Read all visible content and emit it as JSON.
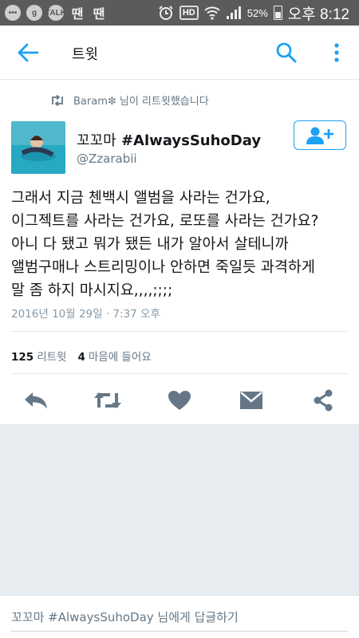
{
  "status_bar": {
    "icons_left": [
      "chat-bubble",
      "g-circle",
      "talk",
      "ttan",
      "ttan"
    ],
    "talk_label": "TALK",
    "ttan_label": "땐",
    "hd": "HD",
    "battery": "52%",
    "time": "오후 8:12"
  },
  "app_bar": {
    "title": "트윗",
    "accent": "#1da1f2"
  },
  "tweet": {
    "retweeted_by": "Baram✼ 님이 리트윗했습니다",
    "author_name_prefix": "꼬꼬마",
    "author_name_tag": "#AlwaysSuhoDay",
    "handle": "@Zzarabii",
    "text_lines": [
      "그래서 지금 첸백시 앨범을 사라는 건가요,",
      "이그젝트를 사라는 건가요, 로또를 사라는 건가요?",
      "아니 다 됐고 뭐가 됐든 내가 알아서 살테니까",
      "앨범구매나 스트리밍이나 안하면 죽일듯 과격하게",
      "말 좀 하지 마시지요,,,,;;;;"
    ],
    "timestamp": "2016년 10월 29일 · 7:37 오후",
    "retweet_count": "125",
    "retweet_label": "리트윗",
    "like_count": "4",
    "like_label": "마음에 들어요"
  },
  "actions": [
    "reply",
    "retweet",
    "like",
    "message",
    "share"
  ],
  "reply_bar": {
    "placeholder": "꼬꼬마 #AlwaysSuhoDay 님에게 답글하기"
  },
  "colors": {
    "accent": "#1da1f2",
    "icon_gray": "#657786",
    "background": "#e6ecf0"
  }
}
